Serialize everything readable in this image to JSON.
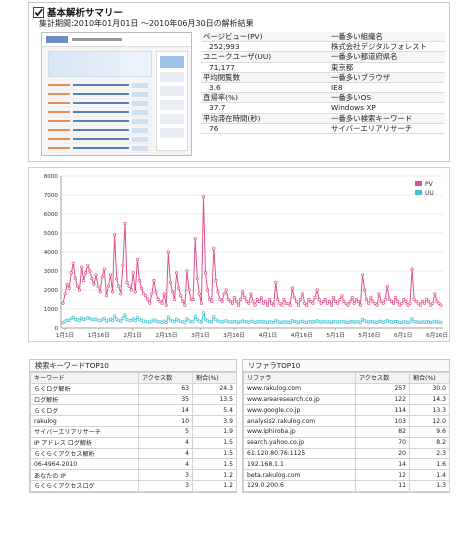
{
  "summary": {
    "title": "基本解析サマリー",
    "period": "集計期間:2010年01月01日 ～2010年06月30日の解析結果",
    "left_stats": [
      {
        "label": "ページビュー(PV)",
        "value": "252,993"
      },
      {
        "label": "ユニークユーザ(UU)",
        "value": "71,177"
      },
      {
        "label": "平均閲覧数",
        "value": "3.6"
      },
      {
        "label": "直帰率(%)",
        "value": "37.7"
      },
      {
        "label": "平均滞在時間(秒)",
        "value": "76"
      }
    ],
    "right_stats": [
      {
        "label": "一番多い組織名",
        "value": "株式会社デジタルフォレスト"
      },
      {
        "label": "一番多い都道府県名",
        "value": "東京都"
      },
      {
        "label": "一番多いブラウザ",
        "value": "IE8"
      },
      {
        "label": "一番多いOS",
        "value": "Windows XP"
      },
      {
        "label": "一番多い検索キーワード",
        "value": "サイバーエリアリサーチ"
      }
    ]
  },
  "colors": {
    "pv": "#e0508a",
    "uu": "#46c0d8"
  },
  "chart_data": {
    "type": "line",
    "ylim": [
      0,
      8000
    ],
    "yticks": [
      "0",
      "1000",
      "2000",
      "3000",
      "4000",
      "5000",
      "6000",
      "7000",
      "8000"
    ],
    "x_tick_labels": [
      "1月1日",
      "1月16日",
      "2月1日",
      "2月15日",
      "3月1日",
      "3月16日",
      "4月1日",
      "4月16日",
      "5月1日",
      "5月16日",
      "6月1日",
      "6月16日"
    ],
    "series": [
      {
        "name": "PV",
        "values": [
          1300,
          1800,
          2300,
          2100,
          2900,
          3400,
          2600,
          2200,
          2000,
          3200,
          2500,
          2900,
          3300,
          3000,
          2600,
          2300,
          2800,
          2200,
          1900,
          2700,
          3100,
          1700,
          2200,
          2800,
          1900,
          4900,
          2600,
          2200,
          1800,
          3300,
          5500,
          2400,
          2200,
          2000,
          2900,
          1900,
          3600,
          2500,
          2100,
          1800,
          1700,
          1500,
          1300,
          1800,
          2500,
          1900,
          1500,
          1400,
          1300,
          1800,
          1200,
          4000,
          2400,
          1900,
          1500,
          2900,
          2100,
          1700,
          1400,
          1200,
          3000,
          2000,
          1500,
          1500,
          4700,
          2600,
          1800,
          1300,
          6900,
          2900,
          2000,
          1500,
          1400,
          4200,
          2500,
          1900,
          1500,
          1400,
          1800,
          2000,
          1500,
          1400,
          1300,
          1600,
          1400,
          1200,
          1500,
          1900,
          1600,
          1400,
          1300,
          1800,
          1400,
          1200,
          1500,
          1400,
          1600,
          1300,
          1400,
          1200,
          1500,
          1300,
          1200,
          2400,
          1500,
          1300,
          1200,
          1500,
          1300,
          1300,
          1200,
          2100,
          1600,
          1400,
          1200,
          1500,
          1800,
          1300,
          1200,
          1500,
          1400,
          1300,
          1600,
          2000,
          1500,
          1300,
          1400,
          1500,
          1300,
          1400,
          1200,
          1600,
          1400,
          1300,
          1500,
          1700,
          1400,
          1300,
          1200,
          1400,
          1600,
          1300,
          1500,
          1400,
          1200,
          2800,
          2000,
          1500,
          1300,
          1600,
          1400,
          1300,
          1200,
          1800,
          1400,
          1300,
          1500,
          2200,
          1500,
          1400,
          1300,
          1600,
          1400,
          1200,
          1300,
          1500,
          1400,
          1200,
          1300,
          3100,
          1500,
          1400,
          1300,
          1200,
          1400,
          1300,
          1500,
          1400,
          1200,
          1300,
          1800,
          1400,
          1300,
          1200
        ]
      },
      {
        "name": "UU",
        "values": [
          280,
          360,
          420,
          400,
          500,
          560,
          460,
          420,
          400,
          520,
          440,
          490,
          540,
          500,
          450,
          420,
          470,
          410,
          380,
          460,
          500,
          360,
          410,
          470,
          380,
          640,
          450,
          410,
          370,
          520,
          700,
          430,
          410,
          390,
          480,
          380,
          560,
          440,
          400,
          360,
          350,
          330,
          300,
          360,
          430,
          370,
          330,
          320,
          300,
          360,
          290,
          580,
          420,
          370,
          330,
          470,
          390,
          350,
          320,
          300,
          480,
          380,
          330,
          330,
          620,
          440,
          360,
          310,
          800,
          470,
          380,
          330,
          320,
          600,
          430,
          370,
          330,
          320,
          360,
          380,
          330,
          320,
          310,
          340,
          320,
          290,
          330,
          370,
          340,
          320,
          310,
          360,
          320,
          290,
          330,
          320,
          340,
          310,
          320,
          290,
          330,
          310,
          290,
          410,
          330,
          310,
          290,
          330,
          310,
          310,
          290,
          390,
          340,
          320,
          290,
          330,
          360,
          310,
          290,
          330,
          320,
          310,
          340,
          380,
          330,
          310,
          320,
          330,
          310,
          320,
          290,
          340,
          320,
          310,
          330,
          350,
          320,
          310,
          290,
          320,
          340,
          310,
          330,
          320,
          290,
          450,
          380,
          330,
          310,
          340,
          320,
          310,
          290,
          360,
          320,
          310,
          330,
          400,
          330,
          320,
          310,
          340,
          320,
          290,
          310,
          330,
          320,
          290,
          310,
          500,
          330,
          320,
          310,
          290,
          320,
          310,
          330,
          320,
          290,
          310,
          360,
          320,
          310,
          290
        ]
      }
    ]
  },
  "keywords": {
    "title": "検索キーワードTOP10",
    "headers": [
      "キーワード",
      "アクセス数",
      "割合(%)"
    ],
    "rows": [
      [
        "らくログ解析",
        "63",
        "24.3"
      ],
      [
        "ログ解析",
        "35",
        "13.5"
      ],
      [
        "らくログ",
        "14",
        "5.4"
      ],
      [
        "rakulog",
        "10",
        "3.9"
      ],
      [
        "サイバーエリアリサーチ",
        "5",
        "1.9"
      ],
      [
        "IP アドレス ログ解析",
        "4",
        "1.5"
      ],
      [
        "らくらくアクセス解析",
        "4",
        "1.5"
      ],
      [
        "06-4964-2010",
        "4",
        "1.5"
      ],
      [
        "あなたの IP",
        "3",
        "1.2"
      ],
      [
        "らくらくアクセスログ",
        "3",
        "1.2"
      ]
    ]
  },
  "referrers": {
    "title": "リファラTOP10",
    "headers": [
      "リファラ",
      "アクセス数",
      "割合(%)"
    ],
    "rows": [
      [
        "www.rakulog.com",
        "257",
        "30.0"
      ],
      [
        "www.arearesearch.co.jp",
        "122",
        "14.3"
      ],
      [
        "www.google.co.jp",
        "114",
        "13.3"
      ],
      [
        "analysis2.rakulog.com",
        "103",
        "12.0"
      ],
      [
        "www.iphiroba.jp",
        "82",
        "9.6"
      ],
      [
        "search.yahoo.co.jp",
        "70",
        "8.2"
      ],
      [
        "61.120.80.76:1125",
        "20",
        "2.3"
      ],
      [
        "192.168.1.1",
        "14",
        "1.6"
      ],
      [
        "beta.rakulog.com",
        "12",
        "1.4"
      ],
      [
        "129.0.200.6",
        "11",
        "1.3"
      ]
    ]
  }
}
